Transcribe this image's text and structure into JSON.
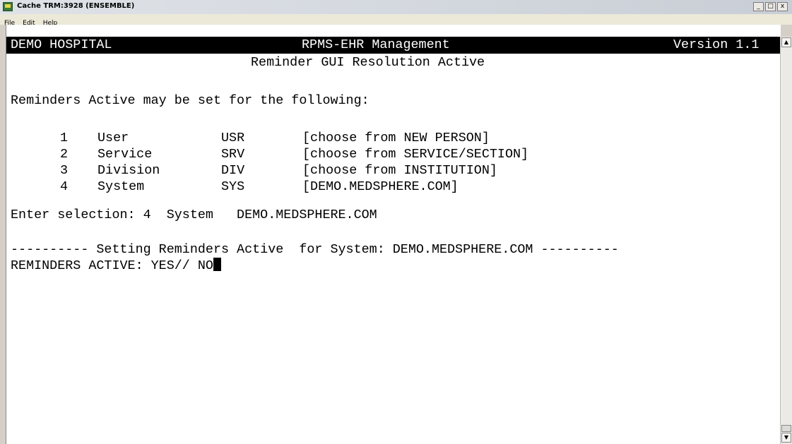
{
  "window": {
    "title": "Cache TRM:3928 (ENSEMBLE)",
    "buttons": {
      "minimize": "_",
      "maximize": "□",
      "close": "x"
    }
  },
  "menu": [
    "File",
    "Edit",
    "Help"
  ],
  "status": {
    "left": "DEMO HOSPITAL",
    "center": "RPMS-EHR Management",
    "right": "Version 1.1"
  },
  "terminal": {
    "heading": "Reminder GUI Resolution Active",
    "intro": "Reminders Active may be set for the following:",
    "options": [
      {
        "num": "1",
        "name": "User",
        "code": "USR",
        "desc": "[choose from NEW PERSON]"
      },
      {
        "num": "2",
        "name": "Service",
        "code": "SRV",
        "desc": "[choose from SERVICE/SECTION]"
      },
      {
        "num": "3",
        "name": "Division",
        "code": "DIV",
        "desc": "[choose from INSTITUTION]"
      },
      {
        "num": "4",
        "name": "System",
        "code": "SYS",
        "desc": "[DEMO.MEDSPHERE.COM]"
      }
    ],
    "selection_prompt": "Enter selection: 4  System   DEMO.MEDSPHERE.COM",
    "setting_line": "---------- Setting Reminders Active  for System: DEMO.MEDSPHERE.COM ----------",
    "input_prompt": "REMINDERS ACTIVE: YES// ",
    "input_value": "NO"
  }
}
